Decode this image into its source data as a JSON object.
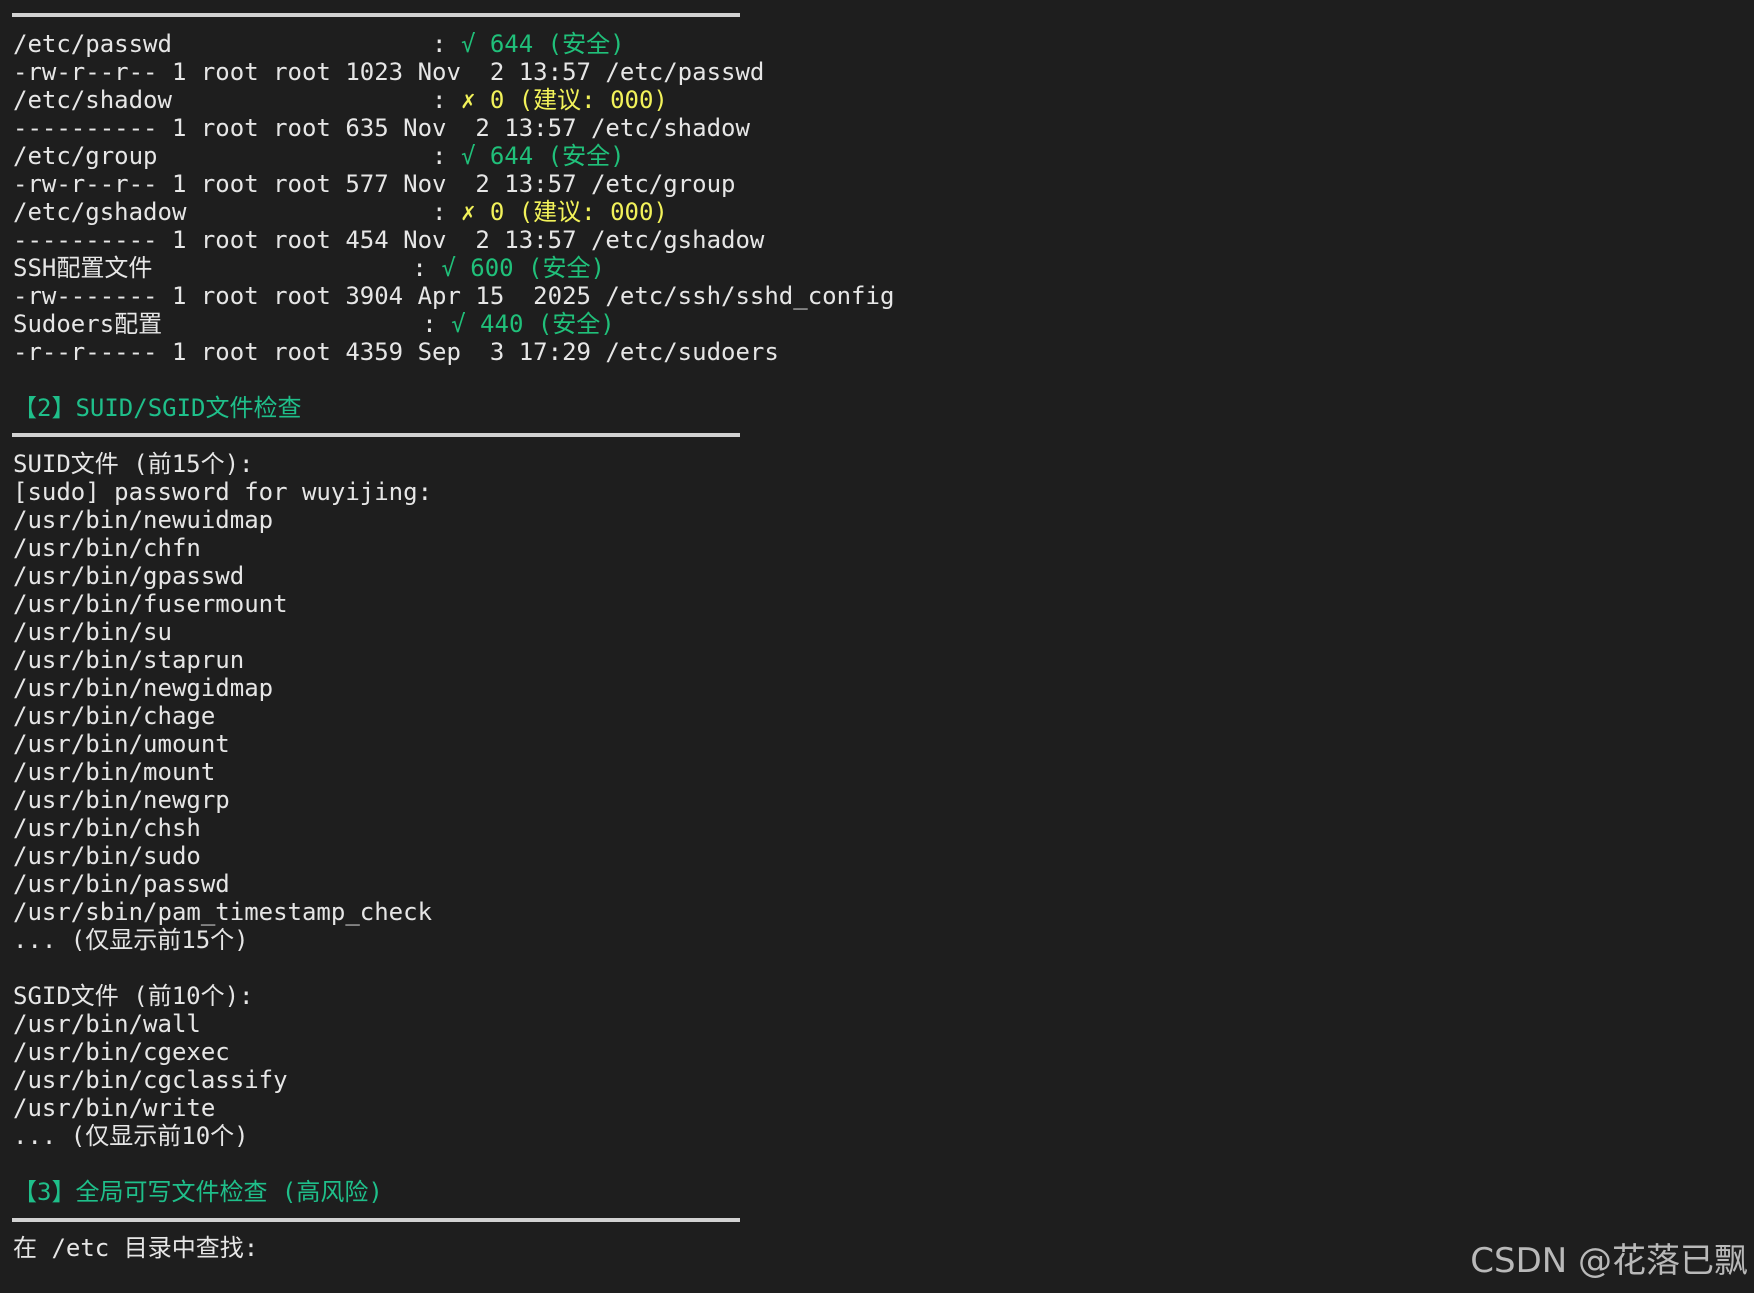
{
  "colors": {
    "background": "#1e1e1e",
    "text": "#e6e6e6",
    "ok": "#20c07a",
    "warn": "#f2f25a",
    "heading": "#1fbf8a",
    "rule": "#d2d2d2",
    "watermark": "#b9b9b9"
  },
  "terminal": {
    "lines": [
      [
        {
          "t": "/etc/passwd                  : ",
          "c": "white"
        },
        {
          "t": "√ 644 (安全)",
          "c": "green"
        }
      ],
      [
        {
          "t": "-rw-r--r-- 1 root root 1023 Nov  2 13:57 /etc/passwd",
          "c": "white"
        }
      ],
      [
        {
          "t": "/etc/shadow                  : ",
          "c": "white"
        },
        {
          "t": "✗ 0 (建议: 000)",
          "c": "yellow"
        }
      ],
      [
        {
          "t": "---------- 1 root root 635 Nov  2 13:57 /etc/shadow",
          "c": "white"
        }
      ],
      [
        {
          "t": "/etc/group                   : ",
          "c": "white"
        },
        {
          "t": "√ 644 (安全)",
          "c": "green"
        }
      ],
      [
        {
          "t": "-rw-r--r-- 1 root root 577 Nov  2 13:57 /etc/group",
          "c": "white"
        }
      ],
      [
        {
          "t": "/etc/gshadow                 : ",
          "c": "white"
        },
        {
          "t": "✗ 0 (建议: 000)",
          "c": "yellow"
        }
      ],
      [
        {
          "t": "---------- 1 root root 454 Nov  2 13:57 /etc/gshadow",
          "c": "white"
        }
      ],
      [
        {
          "t": "SSH配置文件                  : ",
          "c": "white"
        },
        {
          "t": "√ 600 (安全)",
          "c": "green"
        }
      ],
      [
        {
          "t": "-rw------- 1 root root 3904 Apr 15  2025 /etc/ssh/sshd_config",
          "c": "white"
        }
      ],
      [
        {
          "t": "Sudoers配置                  : ",
          "c": "white"
        },
        {
          "t": "√ 440 (安全)",
          "c": "green"
        }
      ],
      [
        {
          "t": "-r--r----- 1 root root 4359 Sep  3 17:29 /etc/sudoers",
          "c": "white"
        }
      ],
      [],
      [
        {
          "t": "【2】SUID/SGID文件检查",
          "c": "cyan"
        }
      ],
      [],
      [
        {
          "t": "SUID文件 (前15个):",
          "c": "white"
        }
      ],
      [
        {
          "t": "[sudo] password for wuyijing:",
          "c": "white"
        }
      ],
      [
        {
          "t": "/usr/bin/newuidmap",
          "c": "white"
        }
      ],
      [
        {
          "t": "/usr/bin/chfn",
          "c": "white"
        }
      ],
      [
        {
          "t": "/usr/bin/gpasswd",
          "c": "white"
        }
      ],
      [
        {
          "t": "/usr/bin/fusermount",
          "c": "white"
        }
      ],
      [
        {
          "t": "/usr/bin/su",
          "c": "white"
        }
      ],
      [
        {
          "t": "/usr/bin/staprun",
          "c": "white"
        }
      ],
      [
        {
          "t": "/usr/bin/newgidmap",
          "c": "white"
        }
      ],
      [
        {
          "t": "/usr/bin/chage",
          "c": "white"
        }
      ],
      [
        {
          "t": "/usr/bin/umount",
          "c": "white"
        }
      ],
      [
        {
          "t": "/usr/bin/mount",
          "c": "white"
        }
      ],
      [
        {
          "t": "/usr/bin/newgrp",
          "c": "white"
        }
      ],
      [
        {
          "t": "/usr/bin/chsh",
          "c": "white"
        }
      ],
      [
        {
          "t": "/usr/bin/sudo",
          "c": "white"
        }
      ],
      [
        {
          "t": "/usr/bin/passwd",
          "c": "white"
        }
      ],
      [
        {
          "t": "/usr/sbin/pam_timestamp_check",
          "c": "white"
        }
      ],
      [
        {
          "t": "... (仅显示前15个)",
          "c": "white"
        }
      ],
      [],
      [
        {
          "t": "SGID文件 (前10个):",
          "c": "white"
        }
      ],
      [
        {
          "t": "/usr/bin/wall",
          "c": "white"
        }
      ],
      [
        {
          "t": "/usr/bin/cgexec",
          "c": "white"
        }
      ],
      [
        {
          "t": "/usr/bin/cgclassify",
          "c": "white"
        }
      ],
      [
        {
          "t": "/usr/bin/write",
          "c": "white"
        }
      ],
      [
        {
          "t": "... (仅显示前10个)",
          "c": "white"
        }
      ],
      [],
      [
        {
          "t": "【3】全局可写文件检查 (高风险)",
          "c": "cyan"
        }
      ],
      [],
      [
        {
          "t": "在 /etc 目录中查找:",
          "c": "white"
        }
      ]
    ]
  },
  "watermark": {
    "text": "CSDN @花落已飘"
  }
}
